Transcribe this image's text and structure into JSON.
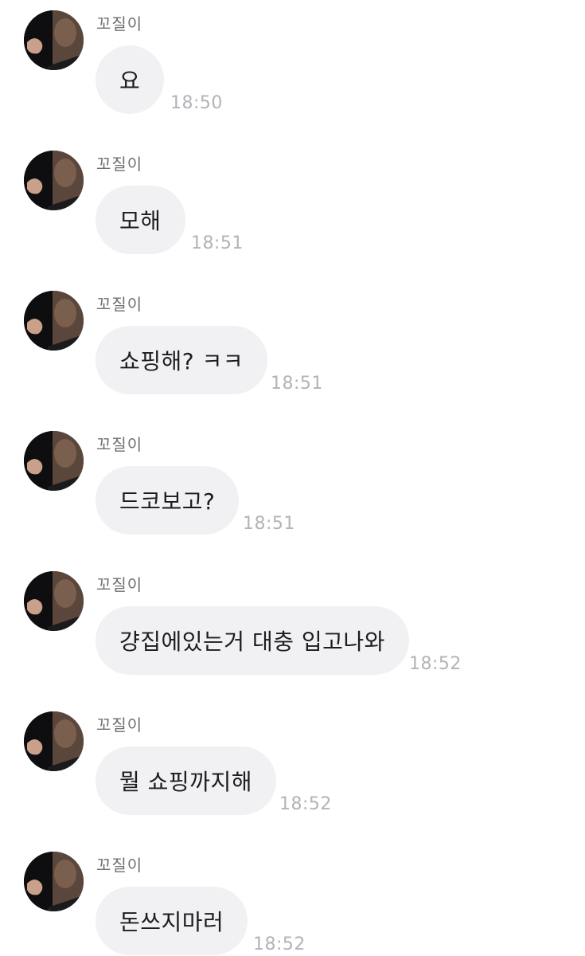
{
  "chat": {
    "messages": [
      {
        "sender": "꼬질이",
        "text": "요",
        "time": "18:50",
        "avatar_icon": "profile-photo-icon"
      },
      {
        "sender": "꼬질이",
        "text": "모해",
        "time": "18:51",
        "avatar_icon": "profile-photo-icon"
      },
      {
        "sender": "꼬질이",
        "text": "쇼핑해? ㅋㅋ",
        "time": "18:51",
        "avatar_icon": "profile-photo-icon"
      },
      {
        "sender": "꼬질이",
        "text": "드코보고?",
        "time": "18:51",
        "avatar_icon": "profile-photo-icon"
      },
      {
        "sender": "꼬질이",
        "text": "걍집에있는거 대충 입고나와",
        "time": "18:52",
        "avatar_icon": "profile-photo-icon"
      },
      {
        "sender": "꼬질이",
        "text": "뭘 쇼핑까지해",
        "time": "18:52",
        "avatar_icon": "profile-photo-icon"
      },
      {
        "sender": "꼬질이",
        "text": "돈쓰지마러",
        "time": "18:52",
        "avatar_icon": "profile-photo-icon"
      }
    ]
  },
  "colors": {
    "background": "#ffffff",
    "bubble": "#f1f1f4",
    "bubble_text": "#1c1c1e",
    "sender_text": "#6f6f73",
    "time_text": "#b3b3b8"
  }
}
